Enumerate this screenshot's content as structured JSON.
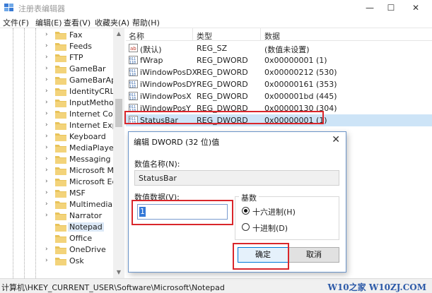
{
  "window": {
    "title": "注册表编辑器",
    "minimize": "—",
    "maximize": "☐",
    "close": "✕"
  },
  "menu": [
    "文件(F)",
    "编辑(E)",
    "查看(V)",
    "收藏夹(A)",
    "帮助(H)"
  ],
  "tree": {
    "items": [
      "Fax",
      "Feeds",
      "FTP",
      "GameBar",
      "GameBarApi",
      "IdentityCRL",
      "InputMethod",
      "Internet Conn",
      "Internet Explo",
      "Keyboard",
      "MediaPlayer",
      "Messaging",
      "Microsoft Ma",
      "Microsoft Edg",
      "MSF",
      "Multimedia",
      "Narrator",
      "Notepad",
      "Office",
      "OneDrive",
      "Osk"
    ],
    "selected": "Notepad"
  },
  "list": {
    "columns": [
      "名称",
      "类型",
      "数据"
    ],
    "rows": [
      {
        "name": "(默认)",
        "type": "REG_SZ",
        "data": "(数值未设置)",
        "icon": "string-value-icon"
      },
      {
        "name": "fWrap",
        "type": "REG_DWORD",
        "data": "0x00000001 (1)",
        "icon": "dword-value-icon"
      },
      {
        "name": "iWindowPosDX",
        "type": "REG_DWORD",
        "data": "0x00000212 (530)",
        "icon": "dword-value-icon"
      },
      {
        "name": "iWindowPosDY",
        "type": "REG_DWORD",
        "data": "0x00000161 (353)",
        "icon": "dword-value-icon"
      },
      {
        "name": "iWindowPosX",
        "type": "REG_DWORD",
        "data": "0x000001bd (445)",
        "icon": "dword-value-icon"
      },
      {
        "name": "iWindowPosY",
        "type": "REG_DWORD",
        "data": "0x00000130 (304)",
        "icon": "dword-value-icon"
      },
      {
        "name": "StatusBar",
        "type": "REG_DWORD",
        "data": "0x00000001 (1)",
        "icon": "dword-value-icon"
      }
    ],
    "selected": "StatusBar"
  },
  "status": {
    "path": "计算机\\HKEY_CURRENT_USER\\Software\\Microsoft\\Notepad",
    "watermark": "W10之家 W10ZJ.COM"
  },
  "dialog": {
    "title": "编辑 DWORD (32 位)值",
    "close": "✕",
    "name_label": "数值名称(N):",
    "name_value": "StatusBar",
    "data_label": "数值数据(V):",
    "data_value": "1",
    "base_label": "基数",
    "base_options": [
      {
        "label": "十六进制(H)",
        "checked": true
      },
      {
        "label": "十进制(D)",
        "checked": false
      }
    ],
    "ok_label": "确定",
    "cancel_label": "取消"
  },
  "colors": {
    "highlight": "#d9262b",
    "selection": "#cde4f7",
    "folder": "#e8c35a",
    "accent": "#0078d7"
  }
}
